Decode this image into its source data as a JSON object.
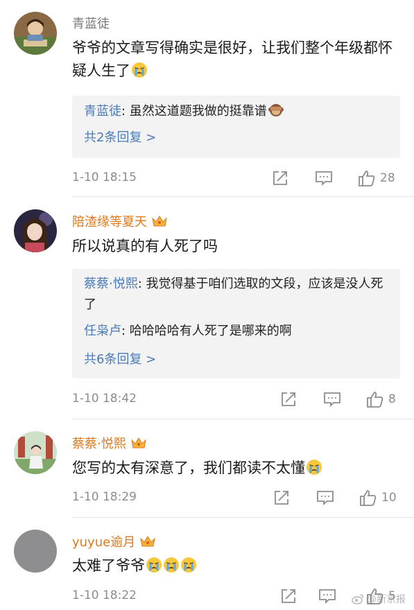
{
  "colors": {
    "name_plain": "#7a7a7a",
    "name_vip": "#e0791c",
    "reply_name": "#4a7bb8",
    "meta_gray": "#8c8c8c",
    "reply_bg": "#f3f3f3"
  },
  "comments": [
    {
      "name": "青蓝徒",
      "vip": false,
      "text": "爷爷的文章写得确实是很好，让我们整个年级都怀疑人生了",
      "emojis": [
        "crying-emoji"
      ],
      "replies": [
        {
          "name": "青蓝徒",
          "sep": ": ",
          "text": "虽然这道题我做的挺靠谱",
          "emoji": "see-no-evil-monkey-emoji"
        }
      ],
      "more_replies": "共2条回复 >",
      "time": "1-10 18:15",
      "likes": "28"
    },
    {
      "name": "陪渣缘等夏天",
      "vip": true,
      "text": "所以说真的有人死了吗",
      "emojis": [],
      "replies": [
        {
          "name": "蔡蔡·悦熙",
          "sep": ": ",
          "text": "我觉得基于咱们选取的文段，应该是没人死了"
        },
        {
          "name": "任枭卢",
          "sep": ": ",
          "text": "哈哈哈哈有人死了是哪来的啊"
        }
      ],
      "more_replies": "共6条回复 >",
      "time": "1-10 18:42",
      "likes": "8"
    },
    {
      "name": "蔡蔡·悦熙",
      "vip": true,
      "text": "您写的太有深意了，我们都读不太懂",
      "emojis": [
        "crying-emoji"
      ],
      "replies": [],
      "more_replies": "",
      "time": "1-10 18:29",
      "likes": "10"
    },
    {
      "name": "yuyue逾月",
      "vip": true,
      "text": "太难了爷爷",
      "emojis": [
        "crying-emoji",
        "crying-emoji",
        "crying-emoji"
      ],
      "replies": [],
      "more_replies": "",
      "time": "1-10 18:22",
      "likes": "5"
    }
  ],
  "watermark": "@新京报"
}
